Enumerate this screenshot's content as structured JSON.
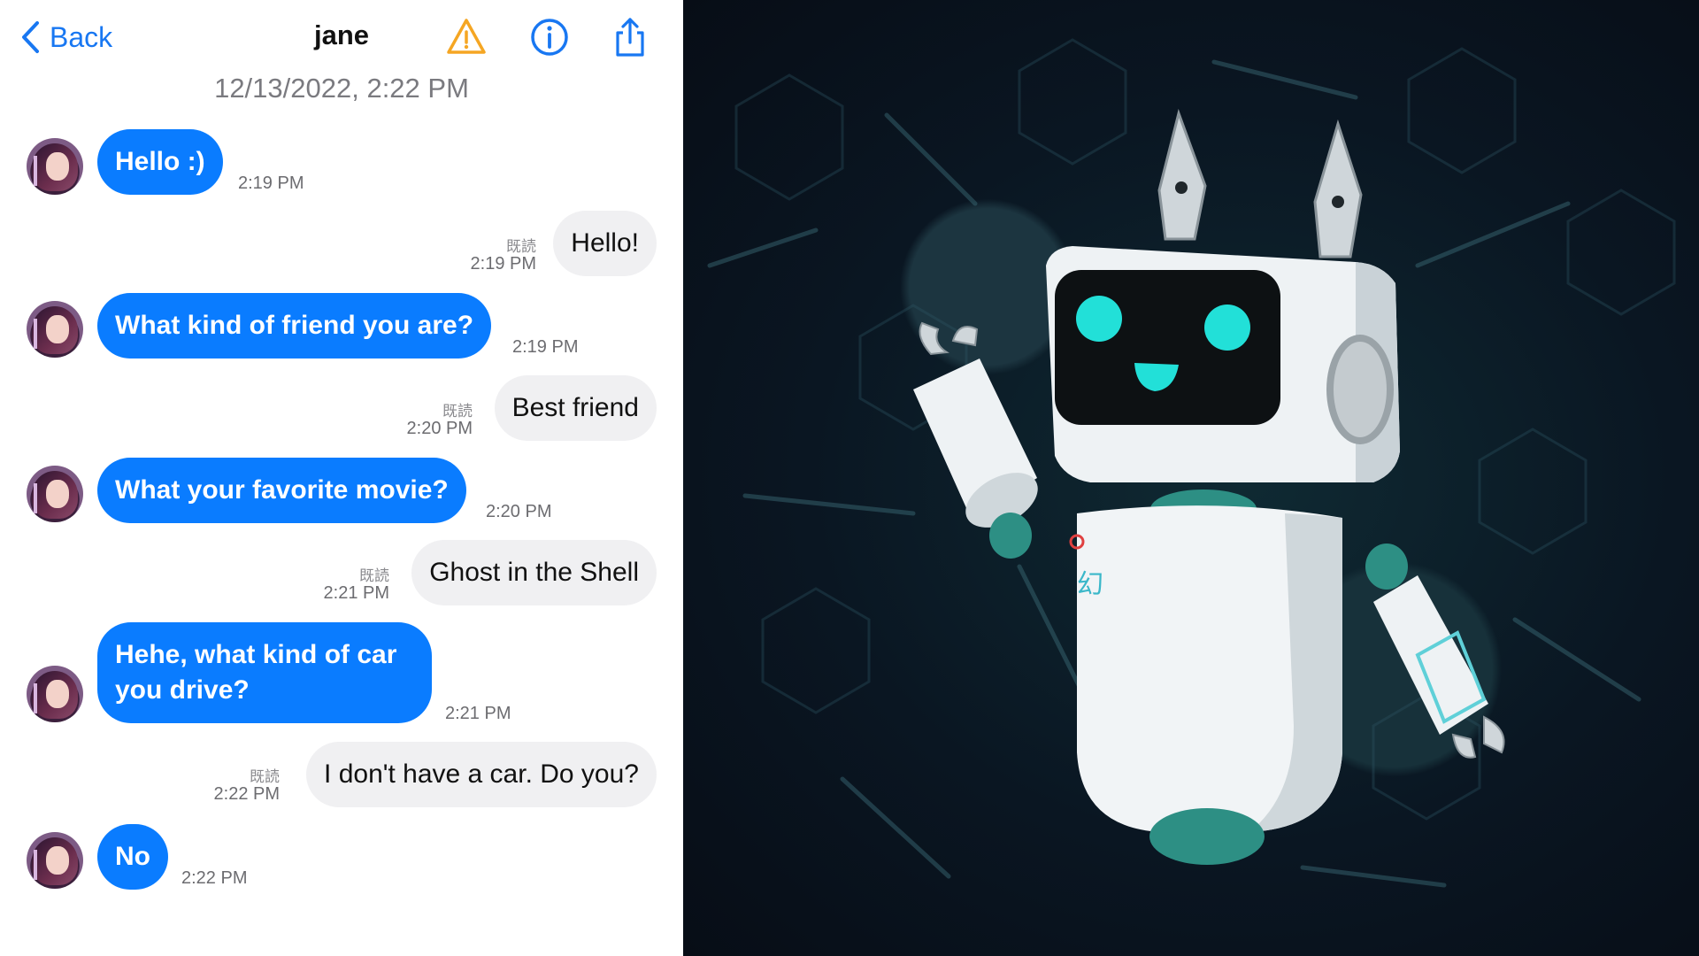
{
  "nav": {
    "back_label": "Back",
    "title": "jane",
    "icons": [
      "warning-icon",
      "info-icon",
      "share-icon"
    ]
  },
  "date_header": "12/13/2022, 2:22 PM",
  "messages": [
    {
      "from": "them",
      "text": "Hello :)",
      "time": "2:19 PM"
    },
    {
      "from": "me",
      "text": "Hello!",
      "read": "既読",
      "time": "2:19 PM"
    },
    {
      "from": "them",
      "text": "What kind of friend you are?",
      "time": "2:19 PM"
    },
    {
      "from": "me",
      "text": "Best friend",
      "read": "既読",
      "time": "2:20 PM"
    },
    {
      "from": "them",
      "text": "What your favorite movie?",
      "time": "2:20 PM"
    },
    {
      "from": "me",
      "text": "Ghost in the Shell",
      "read": "既読",
      "time": "2:21 PM"
    },
    {
      "from": "them",
      "text": "Hehe, what kind of car you drive?",
      "time": "2:21 PM"
    },
    {
      "from": "me",
      "text": "I don't have a car. Do you?",
      "read": "既読",
      "time": "2:22 PM"
    },
    {
      "from": "them",
      "text": "No",
      "time": "2:22 PM"
    }
  ],
  "colors": {
    "accent": "#0a7cff",
    "nav_blue": "#1877f2",
    "warning": "#f5a623",
    "outgoing_bubble": "#f0f0f2",
    "art_background": "#0a1622",
    "robot_eyes": "#22e0d8"
  },
  "artwork": {
    "robot_chest_text": "幻"
  }
}
